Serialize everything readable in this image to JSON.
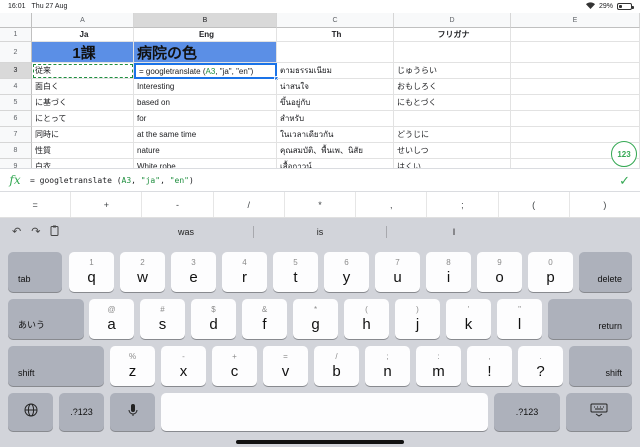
{
  "status": {
    "time": "16:01",
    "date": "Thu 27 Aug",
    "battery": "29%",
    "battery_level": 0.29
  },
  "columns": [
    "A",
    "B",
    "C",
    "D",
    "E"
  ],
  "rows": [
    {
      "num": "1",
      "cells": [
        "Ja",
        "Eng",
        "Th",
        "フリガナ",
        ""
      ]
    },
    {
      "num": "2",
      "cells": [
        "1課",
        "病院の色",
        "",
        "",
        ""
      ]
    },
    {
      "num": "3",
      "cells": [
        "従来",
        "",
        "ตามธรรมเนียม",
        "じゅうらい",
        ""
      ]
    },
    {
      "num": "4",
      "cells": [
        "面白く",
        "Interesting",
        "น่าสนใจ",
        "おもしろく",
        ""
      ]
    },
    {
      "num": "5",
      "cells": [
        "に基づく",
        "based on",
        "ขึ้นอยู่กับ",
        "にもとづく",
        ""
      ]
    },
    {
      "num": "6",
      "cells": [
        "にとって",
        "for",
        "สำหรับ",
        "",
        ""
      ]
    },
    {
      "num": "7",
      "cells": [
        "同時に",
        "at the same time",
        "ในเวลาเดียวกัน",
        "どうじに",
        ""
      ]
    },
    {
      "num": "8",
      "cells": [
        "性質",
        "nature",
        "คุณสมบัติ、พื้นเพ、นิสัย",
        "せいしつ",
        ""
      ]
    },
    {
      "num": "9",
      "cells": [
        "白衣",
        "White robe",
        "เสื้อกาวน์",
        "はくい",
        ""
      ]
    }
  ],
  "active_cell": {
    "formula_prefix": "= googletranslate (",
    "ref": "A3",
    "args": ", \"ja\", \"en\")"
  },
  "fab_label": "123",
  "formula_bar": {
    "fx": "fx",
    "prefix": "= googletranslate (",
    "ref": "A3",
    "sep1": ", ",
    "arg1": "\"ja\"",
    "sep2": ", ",
    "arg2": "\"en\"",
    "close": ")"
  },
  "symbols": [
    "=",
    "+",
    "-",
    "/",
    "*",
    ",",
    ";",
    "(",
    ")"
  ],
  "suggestions": [
    "was",
    "is",
    "I"
  ],
  "keyboard": {
    "row1": [
      [
        "1",
        "q"
      ],
      [
        "2",
        "w"
      ],
      [
        "3",
        "e"
      ],
      [
        "4",
        "r"
      ],
      [
        "5",
        "t"
      ],
      [
        "6",
        "y"
      ],
      [
        "7",
        "u"
      ],
      [
        "8",
        "i"
      ],
      [
        "9",
        "o"
      ],
      [
        "0",
        "p"
      ]
    ],
    "row2": [
      [
        "@",
        "a"
      ],
      [
        "#",
        "s"
      ],
      [
        "$",
        "d"
      ],
      [
        "&",
        "f"
      ],
      [
        "*",
        "g"
      ],
      [
        "(",
        "h"
      ],
      [
        ")",
        "j"
      ],
      [
        "'",
        "k"
      ],
      [
        "\"",
        "l"
      ]
    ],
    "row3": [
      [
        "%",
        "z"
      ],
      [
        "-",
        "x"
      ],
      [
        "+",
        "c"
      ],
      [
        "=",
        "v"
      ],
      [
        "/",
        "b"
      ],
      [
        ";",
        "n"
      ],
      [
        ":",
        "m"
      ],
      [
        ",",
        "!"
      ],
      [
        ".",
        "?"
      ]
    ],
    "tab": "tab",
    "delete": "delete",
    "lang": "あいう",
    "return": "return",
    "shift": "shift",
    "num": ".?123"
  }
}
